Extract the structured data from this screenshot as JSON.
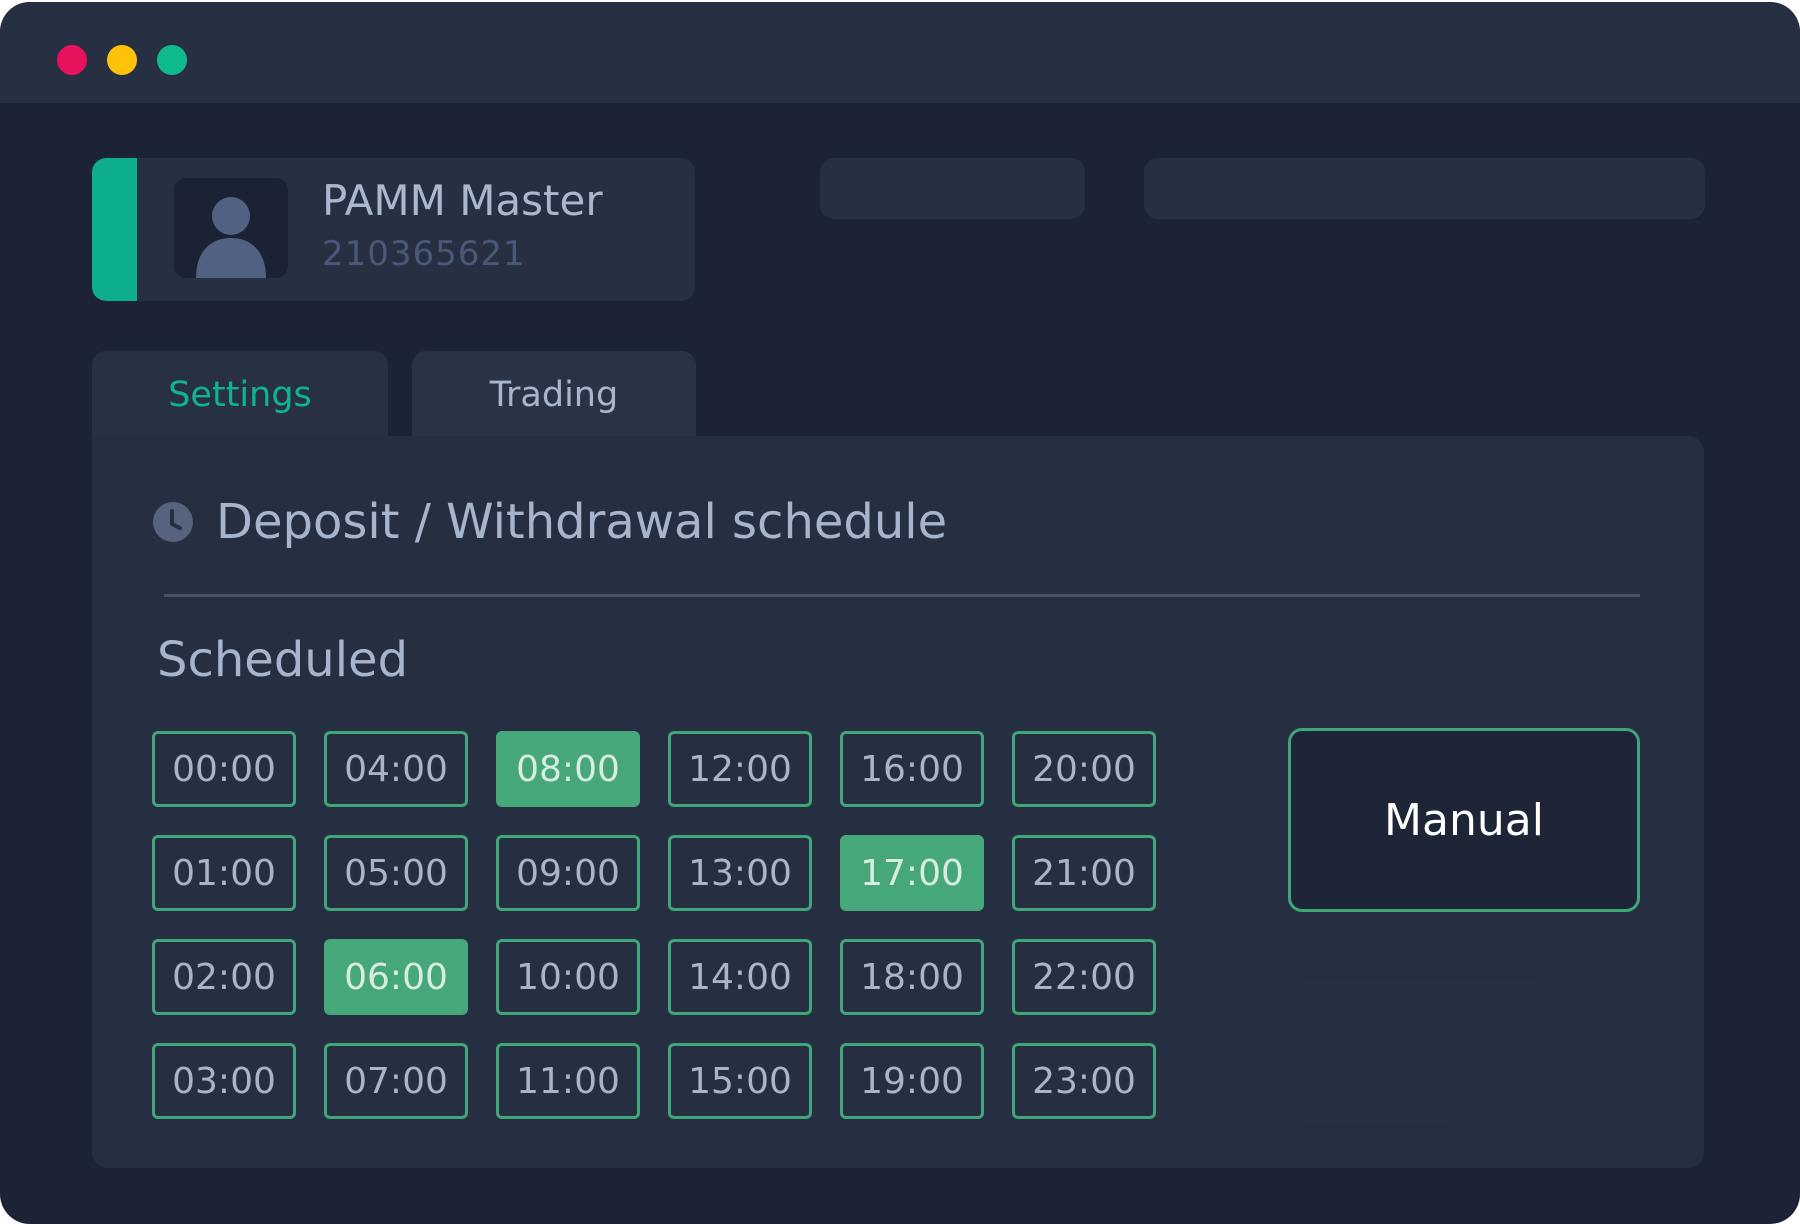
{
  "window": {
    "controls": [
      {
        "name": "close-dot",
        "color": "#e8115c"
      },
      {
        "name": "minimize-dot",
        "color": "#fec209"
      },
      {
        "name": "maximize-dot",
        "color": "#0eba8b"
      }
    ]
  },
  "account": {
    "name": "PAMM Master",
    "id": "210365621",
    "icon": "user-avatar-icon",
    "accent_color": "#0cae8e"
  },
  "tabs": [
    {
      "label": "Settings",
      "active": true
    },
    {
      "label": "Trading",
      "active": false
    }
  ],
  "panel": {
    "title": "Deposit / Withdrawal schedule",
    "title_icon": "clock-icon",
    "section_title": "Scheduled",
    "manual_label": "Manual"
  },
  "schedule": {
    "slots": [
      {
        "time": "00:00",
        "selected": false
      },
      {
        "time": "01:00",
        "selected": false
      },
      {
        "time": "02:00",
        "selected": false
      },
      {
        "time": "03:00",
        "selected": false
      },
      {
        "time": "04:00",
        "selected": false
      },
      {
        "time": "05:00",
        "selected": false
      },
      {
        "time": "06:00",
        "selected": true
      },
      {
        "time": "07:00",
        "selected": false
      },
      {
        "time": "08:00",
        "selected": true
      },
      {
        "time": "09:00",
        "selected": false
      },
      {
        "time": "10:00",
        "selected": false
      },
      {
        "time": "11:00",
        "selected": false
      },
      {
        "time": "12:00",
        "selected": false
      },
      {
        "time": "13:00",
        "selected": false
      },
      {
        "time": "14:00",
        "selected": false
      },
      {
        "time": "15:00",
        "selected": false
      },
      {
        "time": "16:00",
        "selected": false
      },
      {
        "time": "17:00",
        "selected": true
      },
      {
        "time": "18:00",
        "selected": false
      },
      {
        "time": "19:00",
        "selected": false
      },
      {
        "time": "20:00",
        "selected": false
      },
      {
        "time": "21:00",
        "selected": false
      },
      {
        "time": "22:00",
        "selected": false
      },
      {
        "time": "23:00",
        "selected": false
      }
    ]
  },
  "colors": {
    "accent_green": "#0cae8e",
    "slot_border": "#3fa67a",
    "slot_selected": "#45a77a",
    "active_tab_text": "#0fb48e",
    "inactive_tab_text": "#a7b6cc"
  }
}
